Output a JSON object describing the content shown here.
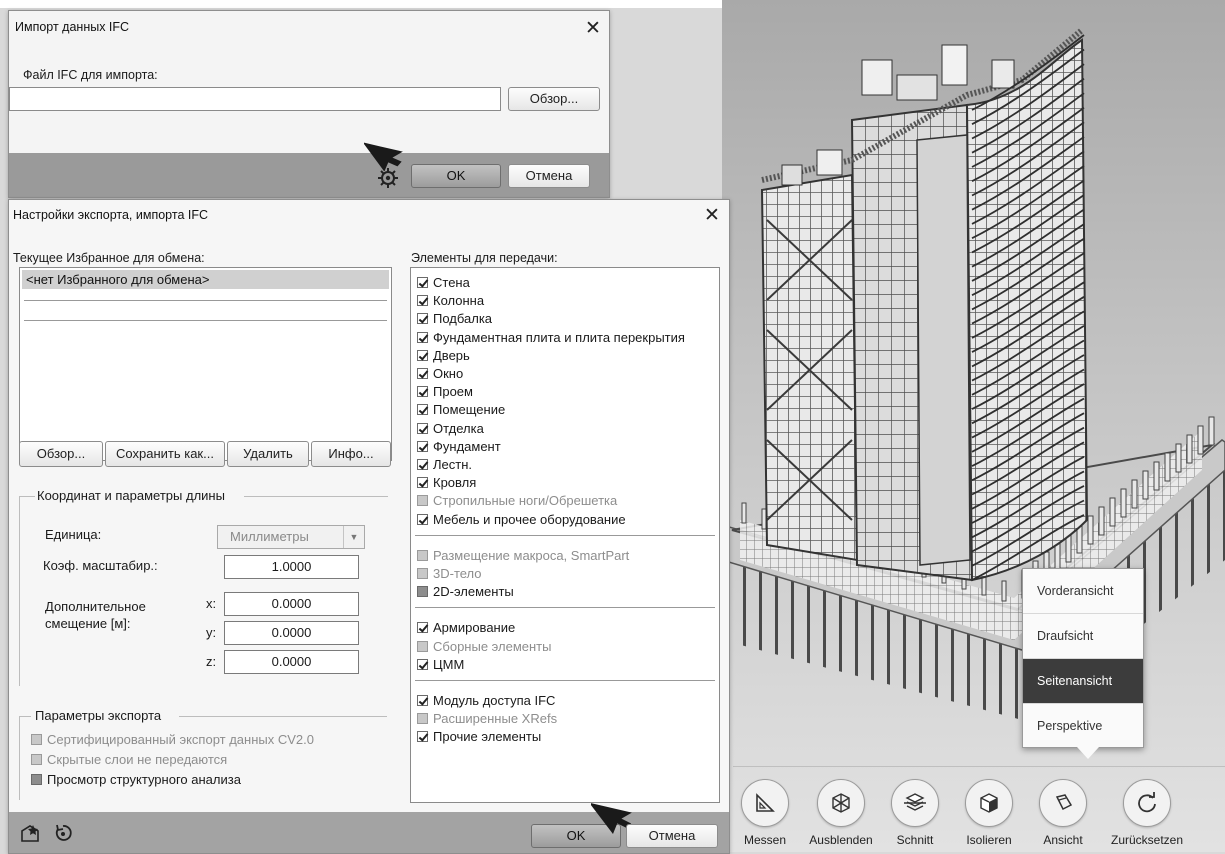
{
  "import_dialog": {
    "title": "Импорт данных IFC",
    "file_label": "Файл IFC для импорта:",
    "file_value": "",
    "browse_label": "Обзор...",
    "ok_label": "OK",
    "cancel_label": "Отмена"
  },
  "settings_dialog": {
    "title": "Настройки экспорта, импорта IFC",
    "favorites_label": "Текущее Избранное для обмена:",
    "favorites_items": [
      "<нет Избранного для обмена>"
    ],
    "buttons": {
      "browse": "Обзор...",
      "save_as": "Сохранить как...",
      "delete": "Удалить",
      "info": "Инфо..."
    },
    "coord_group": {
      "title": "Координат и параметры длины",
      "unit_label": "Единица:",
      "unit_value": "Миллиметры",
      "scale_label": "Коэф. масштабир.:",
      "scale_value": "1.0000",
      "offset_label": "Дополнительное смещение [м]:",
      "x_label": "x:",
      "x_value": "0.0000",
      "y_label": "y:",
      "y_value": "0.0000",
      "z_label": "z:",
      "z_value": "0.0000"
    },
    "export_group": {
      "title": "Параметры экспорта",
      "options": [
        {
          "label": "Сертифицированный экспорт данных CV2.0",
          "state": "disabled"
        },
        {
          "label": "Скрытые слои не передаются",
          "state": "disabled"
        },
        {
          "label": "Просмотр структурного анализа",
          "state": "mid"
        }
      ]
    },
    "elements_label": "Элементы для передачи:",
    "elements": [
      {
        "label": "Стена",
        "state": "checked"
      },
      {
        "label": "Колонна",
        "state": "checked"
      },
      {
        "label": "Подбалка",
        "state": "checked"
      },
      {
        "label": "Фундаментная плита и плита перекрытия",
        "state": "checked"
      },
      {
        "label": "Дверь",
        "state": "checked"
      },
      {
        "label": "Окно",
        "state": "checked"
      },
      {
        "label": "Проем",
        "state": "checked"
      },
      {
        "label": "Помещение",
        "state": "checked"
      },
      {
        "label": "Отделка",
        "state": "checked"
      },
      {
        "label": "Фундамент",
        "state": "checked"
      },
      {
        "label": "Лестн.",
        "state": "checked"
      },
      {
        "label": "Кровля",
        "state": "checked"
      },
      {
        "label": "Стропильные ноги/Обрешетка",
        "state": "disabled"
      },
      {
        "label": "Мебель и прочее оборудование",
        "state": "checked"
      },
      {
        "label": "Размещение макроса, SmartPart",
        "state": "disabled"
      },
      {
        "label": "3D-тело",
        "state": "disabled"
      },
      {
        "label": "2D-элементы",
        "state": "mid"
      },
      {
        "label": "Армирование",
        "state": "checked"
      },
      {
        "label": "Сборные элементы",
        "state": "disabled"
      },
      {
        "label": "ЦММ",
        "state": "checked"
      },
      {
        "label": "Модуль доступа IFC",
        "state": "checked"
      },
      {
        "label": "Расширенные XRefs",
        "state": "disabled"
      },
      {
        "label": "Прочие элементы",
        "state": "checked"
      }
    ],
    "ok_label": "OK",
    "cancel_label": "Отмена"
  },
  "view_menu": {
    "items": [
      "Vorderansicht",
      "Draufsicht",
      "Seitenansicht",
      "Perspektive"
    ],
    "active": "Seitenansicht"
  },
  "toolbar": {
    "items": [
      {
        "label": "Messen",
        "icon": "triangle-ruler-icon"
      },
      {
        "label": "Ausblenden",
        "icon": "cube-outline-icon"
      },
      {
        "label": "Schnitt",
        "icon": "section-cut-icon"
      },
      {
        "label": "Isolieren",
        "icon": "isolate-cube-icon"
      },
      {
        "label": "Ansicht",
        "icon": "view-camera-icon"
      },
      {
        "label": "Zurücksetzen",
        "icon": "reset-arrow-icon"
      }
    ]
  },
  "colors": {
    "dialog_bg": "#f4f4f4",
    "status_bar": "#9a9a9a",
    "menu_active": "#3c3c3c"
  }
}
